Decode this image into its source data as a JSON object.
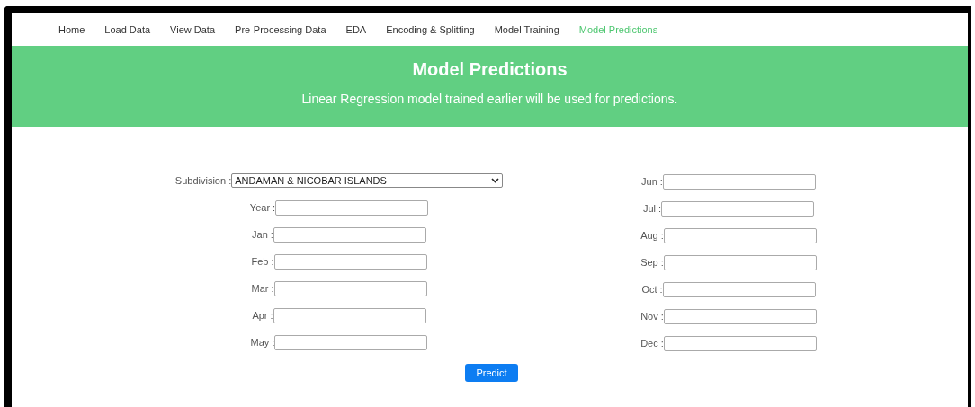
{
  "nav": [
    {
      "label": "Home",
      "selected": false
    },
    {
      "label": "Load Data",
      "selected": false
    },
    {
      "label": "View Data",
      "selected": false
    },
    {
      "label": "Pre-Processing Data",
      "selected": false
    },
    {
      "label": "EDA",
      "selected": false
    },
    {
      "label": "Encoding & Splitting",
      "selected": false
    },
    {
      "label": "Model Training",
      "selected": false
    },
    {
      "label": "Model Predictions",
      "selected": true
    }
  ],
  "header": {
    "title": "Model Predictions",
    "subtitle": "Linear Regression model trained earlier will be used for predictions."
  },
  "form": {
    "left": [
      {
        "kind": "select",
        "label": "Subdivision :",
        "value": "ANDAMAN & NICOBAR ISLANDS"
      },
      {
        "kind": "input",
        "label": "Year :"
      },
      {
        "kind": "input",
        "label": "Jan :"
      },
      {
        "kind": "input",
        "label": "Feb :"
      },
      {
        "kind": "input",
        "label": "Mar :"
      },
      {
        "kind": "input",
        "label": "Apr :"
      },
      {
        "kind": "input",
        "label": "May :"
      }
    ],
    "right": [
      {
        "kind": "input",
        "label": "Jun :"
      },
      {
        "kind": "input",
        "label": "Jul :"
      },
      {
        "kind": "input",
        "label": "Aug :"
      },
      {
        "kind": "input",
        "label": "Sep :"
      },
      {
        "kind": "input",
        "label": "Oct :"
      },
      {
        "kind": "input",
        "label": "Nov :"
      },
      {
        "kind": "input",
        "label": "Dec :"
      }
    ],
    "button": "Predict"
  }
}
